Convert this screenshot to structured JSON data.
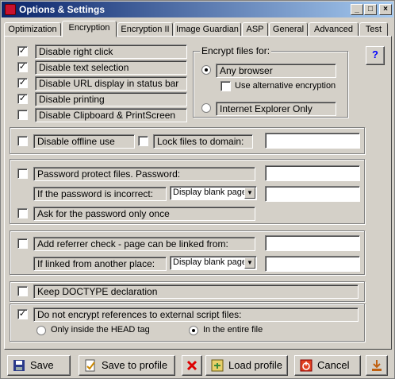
{
  "window": {
    "title": "Options & Settings"
  },
  "tabs": [
    "Optimization",
    "Encryption",
    "Encryption II",
    "Image Guardian",
    "ASP",
    "General",
    "Advanced",
    "Test"
  ],
  "active_tab": "Encryption",
  "help_icon_text": "?",
  "protection": {
    "items": [
      {
        "label": "Disable right click",
        "checked": true
      },
      {
        "label": "Disable text selection",
        "checked": true
      },
      {
        "label": "Disable URL display in status bar",
        "checked": true
      },
      {
        "label": "Disable printing",
        "checked": true
      },
      {
        "label": "Disable Clipboard & PrintScreen",
        "checked": false
      }
    ]
  },
  "encrypt_for": {
    "title": "Encrypt files for:",
    "any_browser": "Any browser",
    "alt_encryption": "Use alternative encryption",
    "ie_only": "Internet Explorer Only",
    "selected": "any_browser"
  },
  "offline": {
    "disable_offline": "Disable offline use",
    "lock_domain": "Lock files to domain:",
    "domain_value": ""
  },
  "password": {
    "protect_label": "Password protect files.  Password:",
    "password_value": "",
    "incorrect_label": "If the password is incorrect:",
    "incorrect_action": "Display blank page",
    "incorrect_value": "",
    "ask_once_label": "Ask for the password only once"
  },
  "referrer": {
    "check_label": "Add referrer check - page can be linked from:",
    "from_value": "",
    "other_label": "If linked from another place:",
    "other_action": "Display blank page",
    "other_value": ""
  },
  "doctype": {
    "label": "Keep DOCTYPE declaration",
    "checked": false
  },
  "scripts": {
    "label": "Do not encrypt references to external script files:",
    "checked": true,
    "head_only": "Only inside the HEAD tag",
    "entire_file": "In the entire file",
    "selected": "entire_file"
  },
  "buttons": {
    "save": "Save",
    "save_profile": "Save to profile",
    "load_profile": "Load profile",
    "cancel": "Cancel"
  },
  "colors": {
    "title_start": "#0a246a",
    "title_end": "#a6caf0",
    "face": "#d4d0c8"
  }
}
